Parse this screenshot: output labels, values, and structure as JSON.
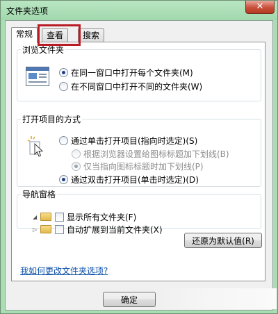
{
  "window": {
    "title": "文件夹选项",
    "close_label": "✕"
  },
  "tabs": [
    {
      "label": "常规",
      "active": true
    },
    {
      "label": "查看",
      "active": false
    },
    {
      "label": "搜索",
      "active": false
    }
  ],
  "browse_folders": {
    "legend": "浏览文件夹",
    "options": [
      {
        "label": "在同一窗口中打开每个文件夹(M)",
        "checked": true
      },
      {
        "label": "在不同窗口中打开不同的文件夹(W)",
        "checked": false
      }
    ]
  },
  "click_items": {
    "legend": "打开项目的方式",
    "options": [
      {
        "label": "通过单击打开项目(指向时选定)(S)",
        "checked": false,
        "disabled": false
      },
      {
        "label": "根据浏览器设置给图标标题加下划线(B)",
        "checked": false,
        "disabled": true
      },
      {
        "label": "仅当指向图标标题时加下划线(P)",
        "checked": true,
        "disabled": true
      },
      {
        "label": "通过双击打开项目(单击时选定)(D)",
        "checked": true,
        "disabled": false
      }
    ]
  },
  "navigation_pane": {
    "legend": "导航窗格",
    "options": [
      {
        "label": "显示所有文件夹(F)",
        "checked": false
      },
      {
        "label": "自动扩展到当前文件夹(X)",
        "checked": false
      }
    ]
  },
  "buttons": {
    "restore_defaults": "还原为默认值(R)",
    "ok": "确定"
  },
  "help_link": "我如何更改文件夹选项?"
}
